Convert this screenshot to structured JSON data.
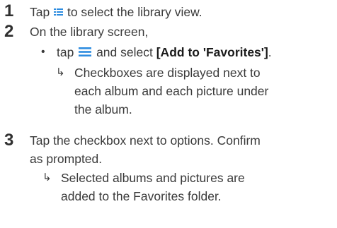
{
  "steps": [
    {
      "number": "1",
      "text_before_icon": "Tap",
      "icon": "library-grid-icon",
      "text_after_icon": "to select the library view."
    },
    {
      "number": "2",
      "text": "On the library screen,",
      "bullet": {
        "marker": "•",
        "text_before_icon": "tap",
        "icon": "menu-icon",
        "text_mid": "and select",
        "bold_text": "[Add to 'Favorites']",
        "text_end": "."
      },
      "result": {
        "marker": "↳",
        "lines": [
          "Checkboxes are displayed next to",
          "each album and each picture under",
          "the album."
        ]
      }
    },
    {
      "number": "3",
      "lines": [
        "Tap the checkbox next to options. Confirm",
        "as prompted."
      ],
      "result": {
        "marker": "↳",
        "lines": [
          "Selected albums and pictures are",
          "added to the Favorites folder."
        ]
      }
    }
  ],
  "colors": {
    "icon_accent": "#2d8ce0",
    "text": "#3a3a3a",
    "step_number": "#303030"
  }
}
